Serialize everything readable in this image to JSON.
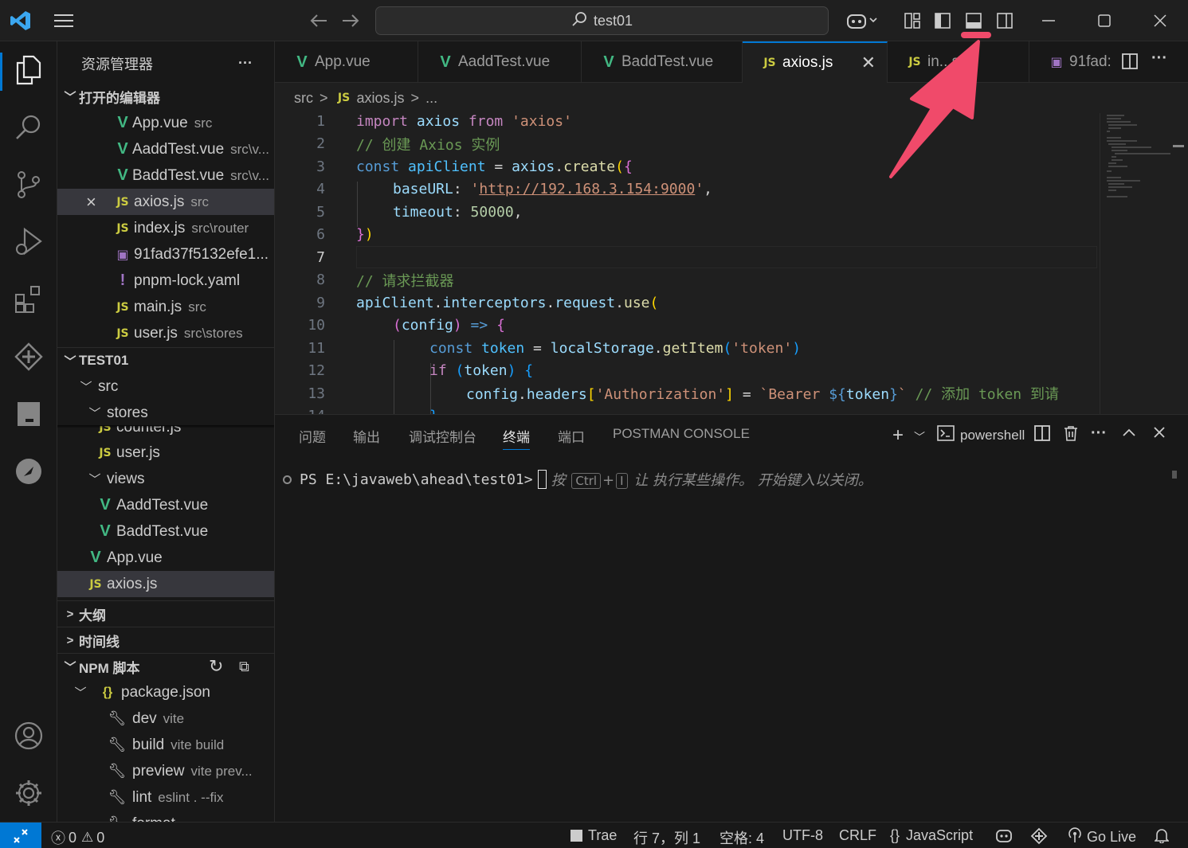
{
  "colors": {
    "accent": "#0078d4",
    "annotation": "#f04a6a",
    "vue": "#42b883",
    "js": "#cbcb41"
  },
  "titlebar": {
    "search_text": "test01",
    "icons": [
      "vscode-logo-icon",
      "menu-icon",
      "back-arrow-icon",
      "forward-arrow-icon",
      "search-icon",
      "copilot-icon",
      "customize-layout-icon",
      "toggle-sidebar-icon",
      "toggle-panel-icon",
      "toggle-secondary-sidebar-icon",
      "minimize-icon",
      "maximize-icon",
      "close-icon"
    ]
  },
  "sidebar": {
    "title": "资源管理器",
    "more": "···",
    "open_editors": {
      "header": "打开的编辑器",
      "items": [
        {
          "name": "App.vue",
          "path": "src",
          "type": "vue"
        },
        {
          "name": "AaddTest.vue",
          "path": "src\\v...",
          "type": "vue"
        },
        {
          "name": "BaddTest.vue",
          "path": "src\\v...",
          "type": "vue"
        },
        {
          "name": "axios.js",
          "path": "src",
          "type": "js",
          "close": "×"
        },
        {
          "name": "index.js",
          "path": "src\\router",
          "type": "js"
        },
        {
          "name": "91fad37f5132efe1...",
          "path": "",
          "type": "image"
        },
        {
          "name": "pnpm-lock.yaml",
          "path": "",
          "type": "yaml"
        },
        {
          "name": "main.js",
          "path": "src",
          "type": "js"
        },
        {
          "name": "user.js",
          "path": "src\\stores",
          "type": "js"
        }
      ]
    },
    "project": {
      "header": "TEST01",
      "src": "src",
      "stores": "stores",
      "counter": "counter.js",
      "user": "user.js",
      "views": "views",
      "aadd": "AaddTest.vue",
      "badd": "BaddTest.vue",
      "app": "App.vue",
      "axios": "axios.js"
    },
    "outline": "大纲",
    "timeline": "时间线",
    "npm": {
      "header": "NPM 脚本",
      "package": "package.json",
      "scripts": [
        {
          "name": "dev",
          "cmd": "vite"
        },
        {
          "name": "build",
          "cmd": "vite build"
        },
        {
          "name": "preview",
          "cmd": "vite prev..."
        },
        {
          "name": "lint",
          "cmd": "eslint . --fix"
        },
        {
          "name": "format",
          "cmd": "..."
        }
      ]
    }
  },
  "tabs": [
    {
      "label": "App.vue",
      "type": "vue"
    },
    {
      "label": "AaddTest.vue",
      "type": "vue"
    },
    {
      "label": "BaddTest.vue",
      "type": "vue"
    },
    {
      "label": "axios.js",
      "type": "js",
      "active": true
    },
    {
      "label": "in...s",
      "type": "js"
    },
    {
      "label": "91fad:",
      "type": "image"
    }
  ],
  "breadcrumb": {
    "folder": "src",
    "file": "axios.js",
    "rest": "..."
  },
  "editor": {
    "current_line": 7,
    "line_numbers": [
      "1",
      "2",
      "3",
      "4",
      "5",
      "6",
      "7",
      "8",
      "9",
      "10",
      "11",
      "12",
      "13",
      "14"
    ],
    "l1": {
      "a": "import",
      "b": " axios ",
      "c": "from",
      "d": " 'axios'"
    },
    "l2": "// 创建 Axios 实例",
    "l3": {
      "a": "const",
      "b": " apiClient",
      "c": " = ",
      "d": "axios",
      "e": ".",
      "f": "create",
      "g": "(",
      "h": "{"
    },
    "l4": {
      "a": "baseURL",
      "b": ": ",
      "q1": "'",
      "url": "http://192.168.3.154:9000",
      "q2": "'",
      "c": ","
    },
    "l5": {
      "a": "timeout",
      "b": ": ",
      "c": "50000",
      "d": ","
    },
    "l6": {
      "a": "}",
      "b": ")"
    },
    "l8": "// 请求拦截器",
    "l9": {
      "a": "apiClient",
      "b": ".",
      "c": "interceptors",
      "d": ".",
      "e": "request",
      "f": ".",
      "g": "use",
      "h": "("
    },
    "l10": {
      "a": "(",
      "b": "config",
      "c": ")",
      "d": " => ",
      "e": "{"
    },
    "l11": {
      "a": "const",
      "b": " token",
      "c": " = ",
      "d": "localStorage",
      "e": ".",
      "f": "getItem",
      "g": "(",
      "h": "'token'",
      "i": ")"
    },
    "l12": {
      "a": "if",
      "b": " (",
      "c": "token",
      "d": ")",
      "e": " {"
    },
    "l13": {
      "a": "config",
      "b": ".",
      "c": "headers",
      "d": "[",
      "e": "'Authorization'",
      "f": "]",
      "g": " = ",
      "h": "`Bearer ",
      "i": "${",
      "j": "token",
      "k": "}",
      "l": "`",
      "m": " // 添加 token 到请"
    },
    "l14": "}"
  },
  "panel": {
    "tabs": [
      "问题",
      "输出",
      "调试控制台",
      "终端",
      "端口",
      "POSTMAN CONSOLE"
    ],
    "active_tab": "终端",
    "shell": "powershell",
    "prompt": "PS E:\\javaweb\\ahead\\test01>",
    "hint_prefix": "按",
    "key1": "Ctrl",
    "plus": "+",
    "key2": "I",
    "hint_suffix": "让 执行某些操作。 开始键入以关闭。"
  },
  "statusbar": {
    "errors": "0",
    "warnings": "0",
    "trae": "Trae",
    "position": "行 7，列 1",
    "spaces": "空格: 4",
    "encoding": "UTF-8",
    "eol": "CRLF",
    "language": "JavaScript",
    "golive": "Go Live"
  }
}
